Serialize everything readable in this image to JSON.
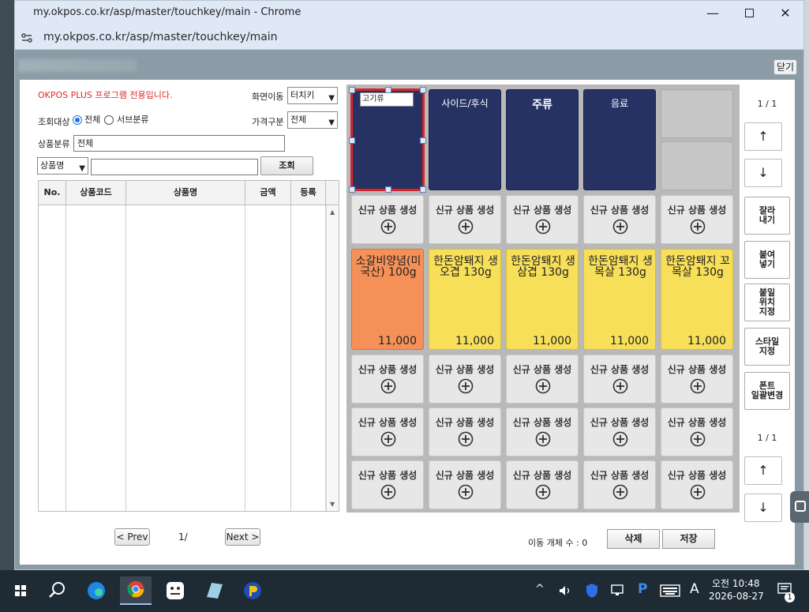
{
  "browser": {
    "title": "my.okpos.co.kr/asp/master/touchkey/main - Chrome",
    "url": "my.okpos.co.kr/asp/master/touchkey/main"
  },
  "header": {
    "close_label": "닫기"
  },
  "left": {
    "notice": "OKPOS PLUS 프로그램 전용입니다.",
    "screen_move_label": "화면이동",
    "screen_move_value": "터치키",
    "target_label": "조회대상",
    "radio_all": "전체",
    "radio_sub": "서브분류",
    "price_label": "가격구분",
    "price_value": "전체",
    "category_label": "상품분류",
    "category_value": "전체",
    "search_field": "상품명",
    "search_button": "조회",
    "columns": [
      "No.",
      "상품코드",
      "상품명",
      "금액",
      "등록"
    ],
    "prev_label": "< Prev",
    "next_label": "Next >",
    "page_num": "1/"
  },
  "keys": {
    "categories": [
      "고기류",
      "사이드/후식",
      "주류",
      "음료"
    ],
    "new_label": "신규 상품 생성",
    "products": [
      {
        "name": "소갈비양념(미국산) 100g",
        "price": "11,000",
        "color": "#f59158"
      },
      {
        "name": "한돈암퇘지 생오겹 130g",
        "price": "11,000",
        "color": "#f7df5a"
      },
      {
        "name": "한돈암퇘지 생삼겹 130g",
        "price": "11,000",
        "color": "#f7df5a"
      },
      {
        "name": "한돈암퇘지 생목살 130g",
        "price": "11,000",
        "color": "#f7df5a"
      },
      {
        "name": "한돈암퇘지 꼬목살 130g",
        "price": "11,000",
        "color": "#f7df5a"
      }
    ]
  },
  "right": {
    "top_pager": "1 / 1",
    "bottom_pager": "1 / 1",
    "up_arrow": "↑",
    "down_arrow": "↓",
    "cut": "잘라\n내기",
    "paste": "붙여\n넣기",
    "paste_position": "붙일\n위치\n지정",
    "style": "스타일\n지정",
    "font_change": "폰트\n일괄변경"
  },
  "footer": {
    "move_count": "이동 개체 수 : 0",
    "delete": "삭제",
    "save": "저장"
  },
  "taskbar": {
    "time": "오전 10:48",
    "date": "2026-08-27",
    "ime": "A",
    "notifications": "1"
  }
}
